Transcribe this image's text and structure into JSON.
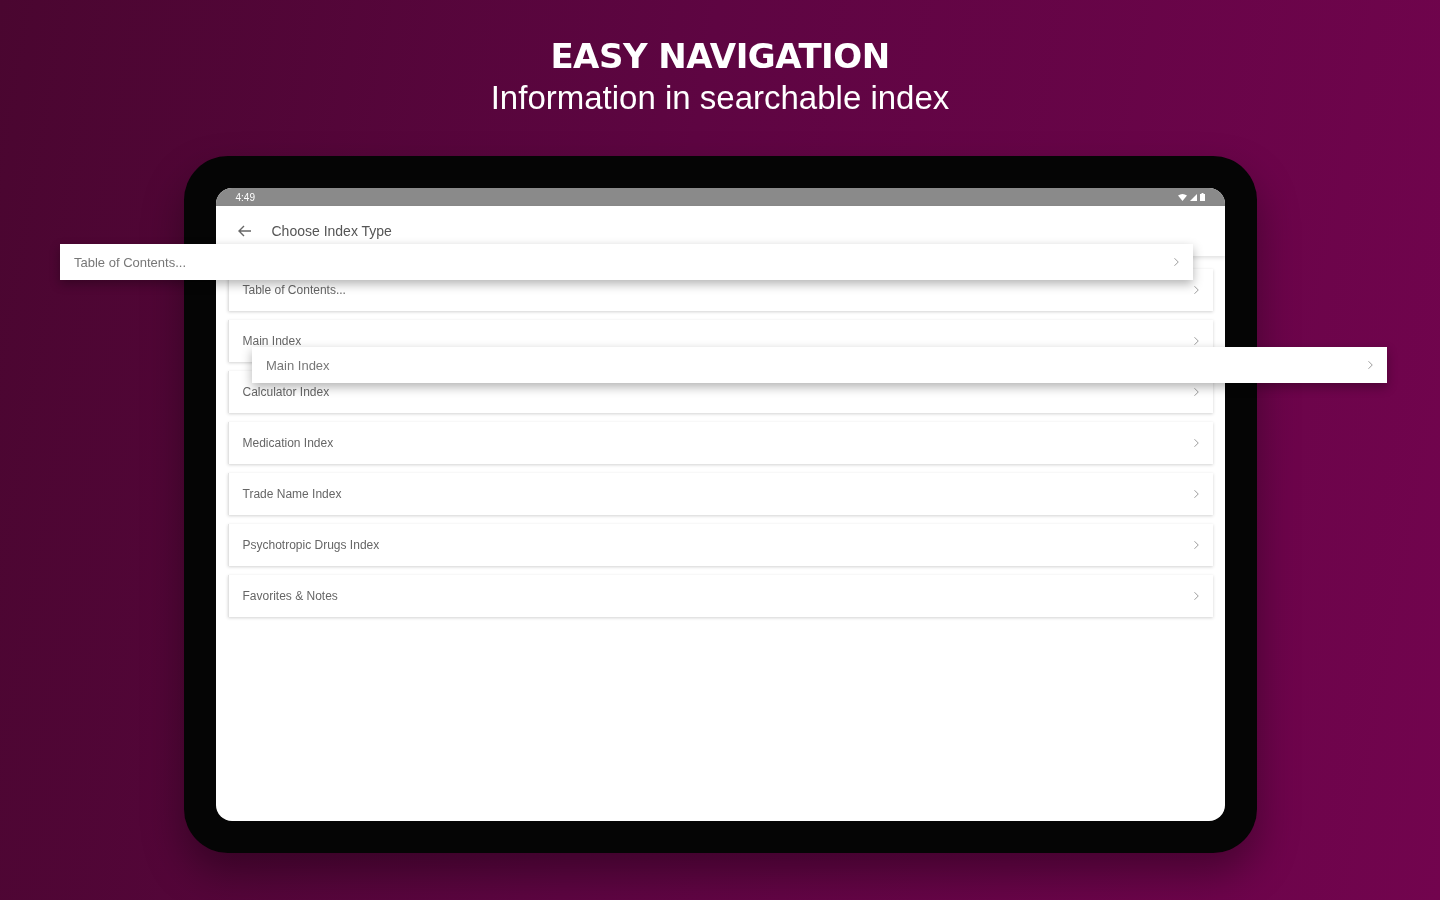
{
  "headline": {
    "title": "EASY NAVIGATION",
    "subtitle": "Information in searchable index"
  },
  "status_bar": {
    "time": "4:49"
  },
  "app_bar": {
    "title": "Choose Index Type"
  },
  "rows": [
    {
      "label": "Table of Contents..."
    },
    {
      "label": "Main Index"
    },
    {
      "label": "Calculator Index"
    },
    {
      "label": "Medication Index"
    },
    {
      "label": "Trade Name Index"
    },
    {
      "label": "Psychotropic Drugs Index"
    },
    {
      "label": "Favorites & Notes"
    }
  ],
  "callouts": [
    {
      "label": "Table of Contents..."
    },
    {
      "label": "Main Index"
    }
  ]
}
